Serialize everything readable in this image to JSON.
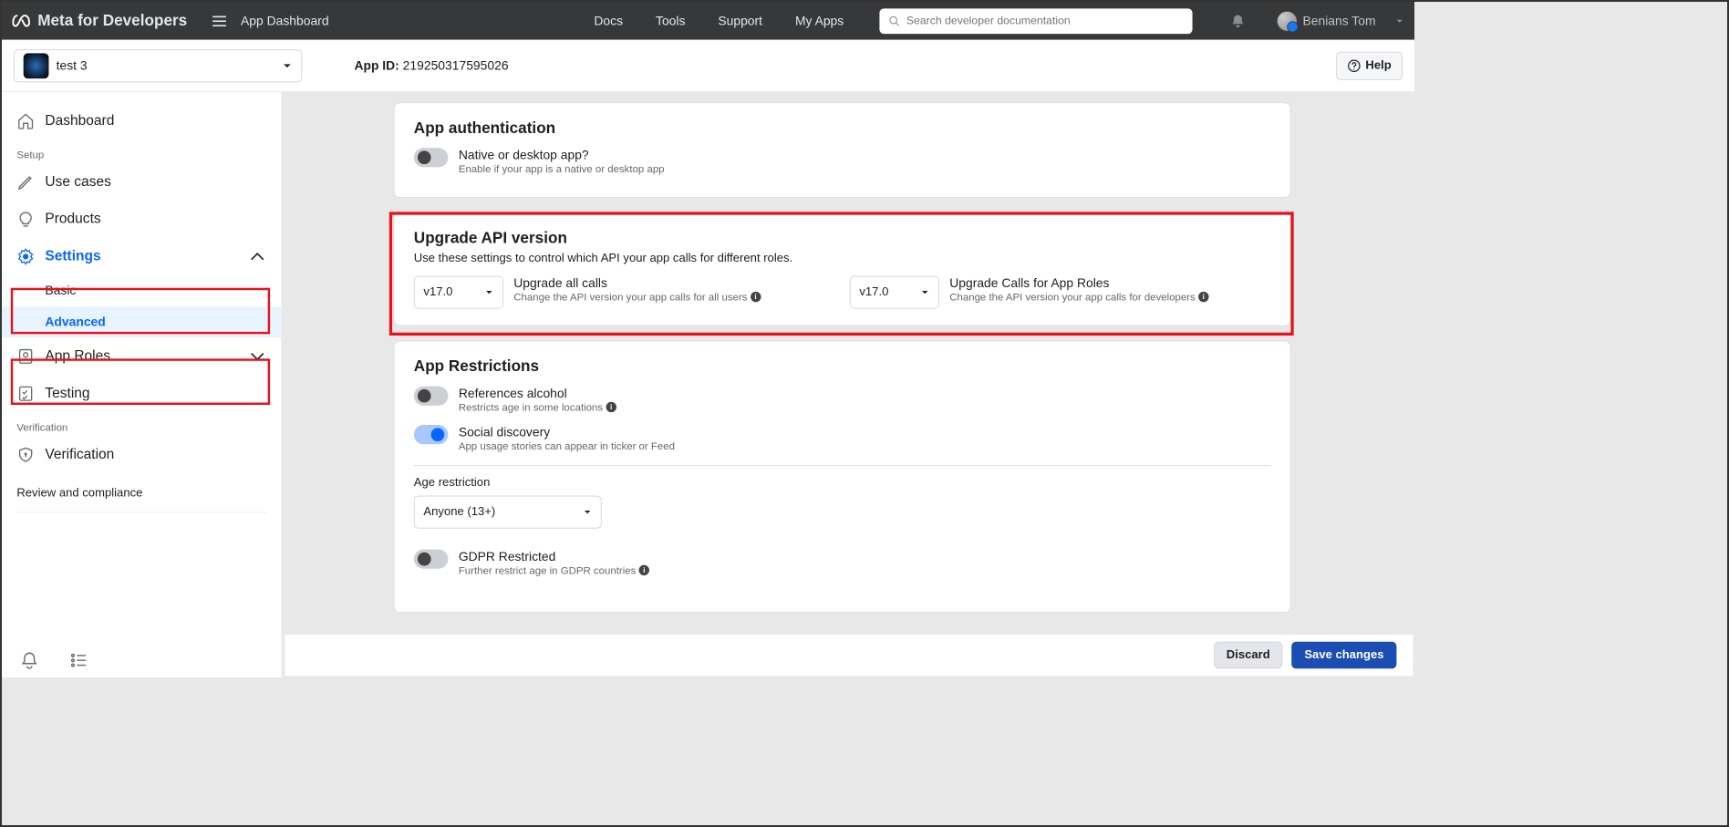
{
  "topbar": {
    "brand": "Meta for Developers",
    "page": "App Dashboard",
    "nav": {
      "docs": "Docs",
      "tools": "Tools",
      "support": "Support",
      "myapps": "My Apps"
    },
    "search_placeholder": "Search developer documentation",
    "user_name": "Benians Tom"
  },
  "appbar": {
    "app_name": "test 3",
    "app_id_label": "App ID:",
    "app_id": "219250317595026",
    "help": "Help"
  },
  "sidebar": {
    "dashboard": "Dashboard",
    "section_setup": "Setup",
    "use_cases": "Use cases",
    "products": "Products",
    "settings": "Settings",
    "settings_basic": "Basic",
    "settings_advanced": "Advanced",
    "app_roles": "App Roles",
    "testing": "Testing",
    "section_verification": "Verification",
    "verification": "Verification",
    "review": "Review and compliance"
  },
  "auth": {
    "title": "App authentication",
    "native_title": "Native or desktop app?",
    "native_sub": "Enable if your app is a native or desktop app"
  },
  "api": {
    "title": "Upgrade API version",
    "desc": "Use these settings to control which API your app calls for different roles.",
    "v1": "v17.0",
    "v2": "v17.0",
    "all_title": "Upgrade all calls",
    "all_sub": "Change the API version your app calls for all users",
    "roles_title": "Upgrade Calls for App Roles",
    "roles_sub": "Change the API version your app calls for developers"
  },
  "restrict": {
    "title": "App Restrictions",
    "alc_title": "References alcohol",
    "alc_sub": "Restricts age in some locations",
    "soc_title": "Social discovery",
    "soc_sub": "App usage stories can appear in ticker or Feed",
    "age_label": "Age restriction",
    "age_value": "Anyone (13+)",
    "gdpr_title": "GDPR Restricted",
    "gdpr_sub": "Further restrict age in GDPR countries"
  },
  "footer": {
    "discard": "Discard",
    "save": "Save changes"
  }
}
